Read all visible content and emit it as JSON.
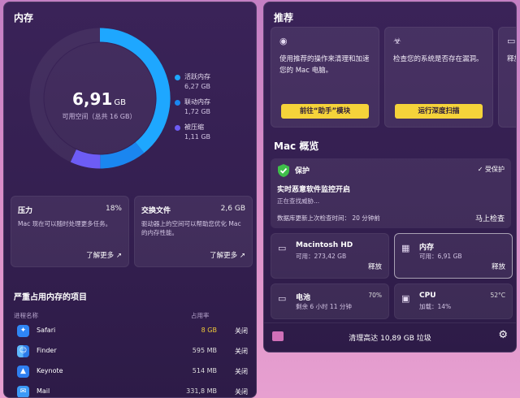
{
  "memory": {
    "title": "内存",
    "available_value": "6,91",
    "available_unit": "GB",
    "available_label": "可用空间（总共 16 GB）",
    "legend": [
      {
        "name": "活跃内存",
        "value": "6,27 GB",
        "color": "#1ea7ff"
      },
      {
        "name": "联动内存",
        "value": "1,72 GB",
        "color": "#1a86f0"
      },
      {
        "name": "被压缩",
        "value": "1,11 GB",
        "color": "#6d5cf5"
      }
    ],
    "donut": {
      "active": 6.27,
      "wired": 1.72,
      "compressed": 1.11,
      "total": 16
    }
  },
  "pressure": {
    "title": "压力",
    "value": "18%",
    "desc": "Mac 现在可以随时处理更多任务。",
    "more": "了解更多 ↗"
  },
  "swap": {
    "title": "交换文件",
    "value": "2,6 GB",
    "desc": "驱动器上的空间可以帮助您优化 Mac 的内存性能。",
    "more": "了解更多 ↗"
  },
  "top_apps": {
    "title": "严重占用内存的项目",
    "col_name": "进程名称",
    "col_usage": "占用率",
    "rows": [
      {
        "name": "Safari",
        "mem": "8 GB",
        "action": "关闭",
        "icon": "safari-icon",
        "highlight": true
      },
      {
        "name": "Finder",
        "mem": "595 MB",
        "action": "关闭",
        "icon": "finder-icon",
        "highlight": false
      },
      {
        "name": "Keynote",
        "mem": "514 MB",
        "action": "关闭",
        "icon": "keynote-icon",
        "highlight": false
      },
      {
        "name": "Mail",
        "mem": "331,8 MB",
        "action": "关闭",
        "icon": "mail-icon",
        "highlight": false
      }
    ]
  },
  "recommend": {
    "title": "推荐",
    "cards": [
      {
        "text": "使用推荐的操作来清理和加速您的 Mac 电脑。",
        "button": "前往“助手”模块",
        "icon": "assistant-icon"
      },
      {
        "text": "检查您的系统是否存在漏洞。",
        "button": "运行深度扫描",
        "icon": "biohazard-icon"
      },
      {
        "text": "释放",
        "button": "",
        "icon": "drive-icon"
      }
    ]
  },
  "overview": {
    "title": "Mac 概览",
    "protection": {
      "title": "保护",
      "status": "受保护",
      "headline": "实时恶意软件监控开启",
      "sub": "正在查找威胁...",
      "db_text": "数据库更新上次检查时间： 20 分钟前",
      "check_button": "马上检查"
    },
    "disk": {
      "title": "Macintosh HD",
      "sub": "可用：273,42 GB",
      "action": "释放"
    },
    "mem": {
      "title": "内存",
      "sub": "可用：6,91 GB",
      "action": "释放"
    },
    "battery": {
      "title": "电池",
      "sub": "剩余 6 小时 11 分钟",
      "value": "70%"
    },
    "cpu": {
      "title": "CPU",
      "sub": "加载：14%",
      "value": "52°C"
    }
  },
  "footer": {
    "text": "清理高达 10,89 GB 垃圾"
  }
}
